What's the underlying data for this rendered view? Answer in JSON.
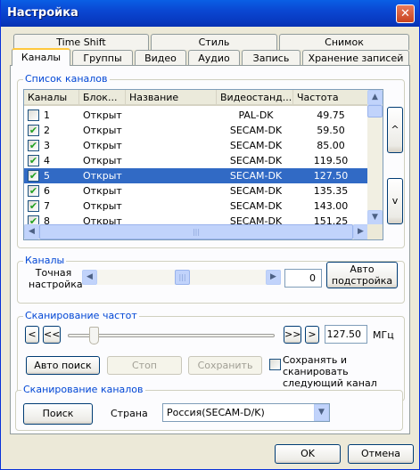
{
  "window": {
    "title": "Настройка",
    "close_symbol": "✕"
  },
  "tabs_row1": [
    "Time Shift",
    "Стиль",
    "Снимок"
  ],
  "tabs_row2": [
    "Каналы",
    "Группы",
    "Видео",
    "Аудио",
    "Запись",
    "Хранение записей"
  ],
  "channel_list": {
    "group_title": "Список каналов",
    "columns": [
      "Каналы",
      "Блок...",
      "Название",
      "Видеостанд...",
      "Частота"
    ],
    "rows": [
      {
        "checked": false,
        "num": "1",
        "block": "Открыт",
        "name": "",
        "standard": "PAL-DK",
        "freq": "49.75"
      },
      {
        "checked": true,
        "num": "2",
        "block": "Открыт",
        "name": "",
        "standard": "SECAM-DK",
        "freq": "59.50"
      },
      {
        "checked": true,
        "num": "3",
        "block": "Открыт",
        "name": "",
        "standard": "SECAM-DK",
        "freq": "85.00"
      },
      {
        "checked": true,
        "num": "4",
        "block": "Открыт",
        "name": "",
        "standard": "SECAM-DK",
        "freq": "119.50"
      },
      {
        "checked": true,
        "num": "5",
        "block": "Открыт",
        "name": "",
        "standard": "SECAM-DK",
        "freq": "127.50"
      },
      {
        "checked": true,
        "num": "6",
        "block": "Открыт",
        "name": "",
        "standard": "SECAM-DK",
        "freq": "135.35"
      },
      {
        "checked": true,
        "num": "7",
        "block": "Открыт",
        "name": "",
        "standard": "SECAM-DK",
        "freq": "143.00"
      },
      {
        "checked": true,
        "num": "8",
        "block": "Открыт",
        "name": "",
        "standard": "SECAM-DK",
        "freq": "151.25"
      }
    ],
    "selected_row": 4,
    "move_up": "^",
    "move_down": "v"
  },
  "channels_group": {
    "title": "Каналы",
    "fine_tune_label": "Точная\nнастройка",
    "fine_tune_value": "0",
    "auto_tune_button": "Авто\nподстройка"
  },
  "scan_freq_group": {
    "title": "Сканирование частот",
    "step_back": "<",
    "fast_back": "<<",
    "fast_forward": ">>",
    "step_forward": ">",
    "frequency": "127.50",
    "unit": "МГц",
    "auto_search_button": "Авто поиск",
    "stop_button": "Стоп",
    "save_button": "Сохранить",
    "save_and_scan_label": "Сохранять и сканировать\nследующий канал"
  },
  "scan_channels_group": {
    "title": "Сканирование каналов",
    "search_button": "Поиск",
    "country_label": "Страна",
    "country_value": "Россия(SECAM-D/K)"
  },
  "footer": {
    "ok": "OK",
    "cancel": "Отмена"
  }
}
